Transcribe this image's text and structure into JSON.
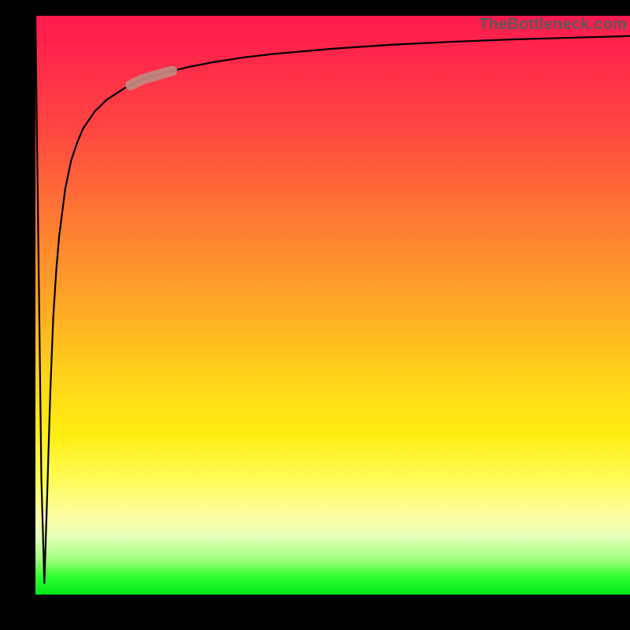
{
  "watermark": "TheBottleneck.com",
  "colors": {
    "frame": "#000000",
    "gradient_top": "#ff1a4d",
    "gradient_mid1": "#ff7a33",
    "gradient_mid2": "#ffed10",
    "gradient_bottom": "#00e81a",
    "curve": "#000000",
    "highlight": "#c08a80"
  },
  "chart_data": {
    "type": "line",
    "title": "",
    "xlabel": "",
    "ylabel": "",
    "xlim": [
      0,
      100
    ],
    "ylim": [
      0,
      100
    ],
    "grid": false,
    "legend": false,
    "x": [
      0,
      0.5,
      1,
      1.5,
      2,
      2.5,
      3,
      3.5,
      4,
      5,
      6,
      7,
      8,
      10,
      12,
      15,
      18,
      22,
      26,
      30,
      35,
      40,
      50,
      60,
      70,
      80,
      90,
      100
    ],
    "y": [
      100,
      60,
      20,
      2,
      18,
      35,
      48,
      56,
      62,
      70,
      75,
      78,
      80.5,
      83.5,
      85.5,
      87.5,
      89,
      90.2,
      91.2,
      92,
      92.8,
      93.4,
      94.3,
      95,
      95.5,
      95.9,
      96.2,
      96.5
    ],
    "highlight_segment": {
      "x_range": [
        16,
        23
      ],
      "note": "pale salmon capsule marker on curve"
    }
  }
}
